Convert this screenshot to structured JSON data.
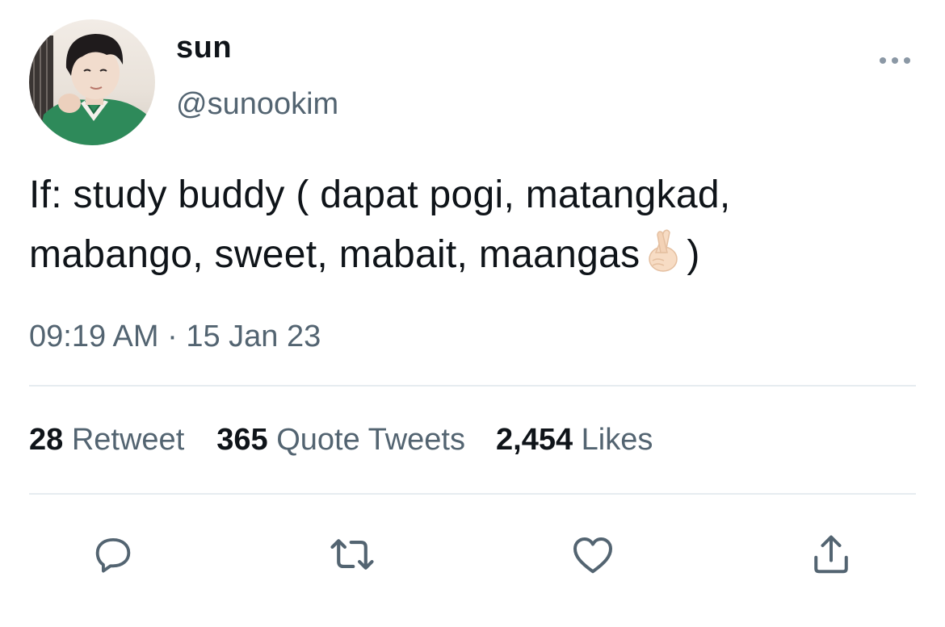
{
  "tweet": {
    "author": {
      "display_name": "sun",
      "handle": "@sunookim"
    },
    "text": {
      "line1": "If: study buddy ( dapat pogi, matangkad,",
      "line2_before_emoji": "mabango, sweet, mabait, maangas",
      "emoji": "crossed-fingers-emoji",
      "line2_after_emoji": ")"
    },
    "timestamp": "09:19 AM · 15 Jan 23",
    "stats": {
      "retweets_count": "28",
      "retweets_label": "Retweet",
      "quotes_count": "365",
      "quotes_label": "Quote Tweets",
      "likes_count": "2,454",
      "likes_label": "Likes"
    },
    "actions": [
      {
        "icon": "reply-icon"
      },
      {
        "icon": "retweet-icon"
      },
      {
        "icon": "heart-icon"
      },
      {
        "icon": "share-icon"
      }
    ],
    "colors": {
      "text": "#0f1419",
      "secondary": "#536471",
      "divider": "#e6ecf0"
    }
  }
}
